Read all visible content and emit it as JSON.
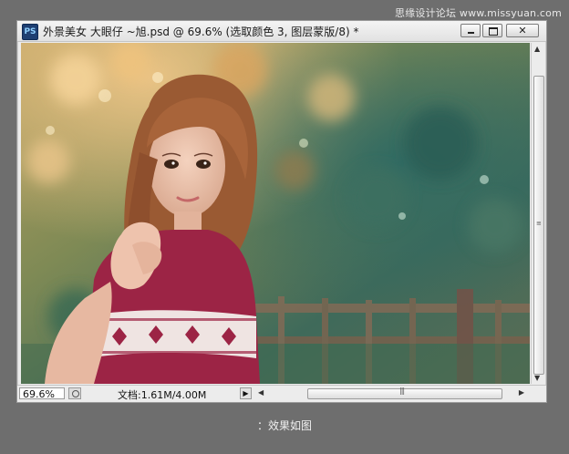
{
  "watermark": "思缘设计论坛  www.missyuan.com",
  "window": {
    "app_icon": "PS",
    "title": "外景美女 大眼仔 ~旭.psd @ 69.6% (选取颜色 3, 图层蒙版/8) *",
    "controls": {
      "close_glyph": "✕"
    }
  },
  "photo": {
    "subject": "portrait"
  },
  "statusbar": {
    "zoom": "69.6%",
    "doc_info": "文档:1.61M/4.00M",
    "info_arrow": "▶"
  },
  "scroll": {
    "up": "▲",
    "down": "▼",
    "left": "◀",
    "right": "▶"
  },
  "caption": "：效果如图"
}
